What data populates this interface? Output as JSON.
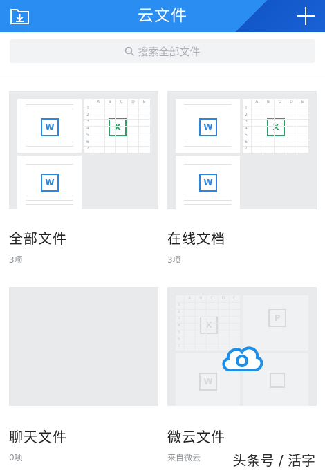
{
  "header": {
    "title": "云文件",
    "folder_icon": "folder-download-icon",
    "add_icon": "plus-icon"
  },
  "search": {
    "placeholder": "搜索全部文件",
    "icon": "search-icon"
  },
  "folders": [
    {
      "name": "全部文件",
      "count": "3项"
    },
    {
      "name": "在线文档",
      "count": "3项"
    },
    {
      "name": "聊天文件",
      "count": "0项"
    },
    {
      "name": "微云文件",
      "count": "来自微云"
    }
  ],
  "sheet_cols": [
    "A",
    "B",
    "C",
    "D",
    "E"
  ],
  "sheet_rows": [
    "1",
    "2",
    "3",
    "4",
    "5",
    "6",
    "7"
  ],
  "icon_glyphs": {
    "word": "W",
    "excel": "X",
    "ppt": "P"
  },
  "watermark": "头条号 / 活字",
  "colors": {
    "header": "#2a8df2",
    "word": "#2a86e0",
    "excel": "#21a561",
    "cloud": "#1e8ee6"
  }
}
